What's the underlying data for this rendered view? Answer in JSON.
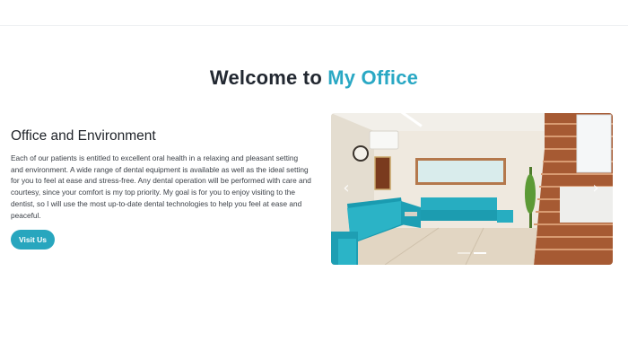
{
  "hero": {
    "title_prefix": "Welcome to",
    "title_accent": "My Office"
  },
  "section": {
    "title": "Office and Environment",
    "body": "Each of our patients is entitled to excellent oral health in a relaxing and pleasant setting and environment. A wide range of dental equipment is available as well as the ideal setting for you to feel at ease and stress-free. Any dental operation will be performed with care and courtesy, since your comfort is my top priority. My goal is for you to enjoy visiting to the dentist, so I will use the most up-to-date dental technologies to help you feel at ease and peaceful.",
    "button_label": "Visit Us"
  },
  "carousel": {
    "prev_icon": "chevron-left-icon",
    "next_icon": "chevron-right-icon",
    "slide_count": 2,
    "active_slide": 1
  },
  "colors": {
    "accent": "#2aa8c4",
    "button": "#28a6be",
    "heading": "#222831"
  }
}
